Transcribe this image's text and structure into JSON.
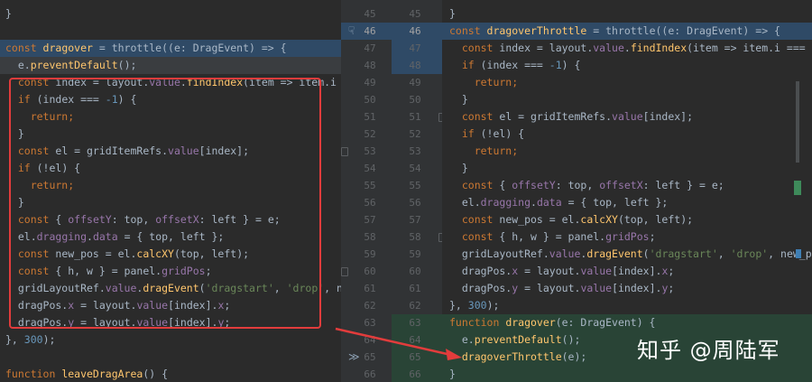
{
  "left_lines": [
    [
      {
        "t": "}",
        "k": "plain"
      }
    ],
    [],
    [
      {
        "t": "const ",
        "k": "kw"
      },
      {
        "t": "dragover",
        "k": "fn"
      },
      {
        "t": " = throttle((e: DragEvent) => {",
        "k": "plain"
      }
    ],
    [
      {
        "t": "  e.",
        "k": "plain"
      },
      {
        "t": "preventDefault",
        "k": "fn"
      },
      {
        "t": "();",
        "k": "plain"
      }
    ],
    [
      {
        "t": "  const ",
        "k": "kw"
      },
      {
        "t": "index = layout.",
        "k": "plain"
      },
      {
        "t": "value",
        "k": "prop"
      },
      {
        "t": ".",
        "k": "plain"
      },
      {
        "t": "findIndex",
        "k": "fn"
      },
      {
        "t": "(item => item.i ==",
        "k": "plain"
      }
    ],
    [
      {
        "t": "  if ",
        "k": "kw"
      },
      {
        "t": "(index === ",
        "k": "plain"
      },
      {
        "t": "-1",
        "k": "num"
      },
      {
        "t": ") {",
        "k": "plain"
      }
    ],
    [
      {
        "t": "    return;",
        "k": "kw"
      }
    ],
    [
      {
        "t": "  }",
        "k": "plain"
      }
    ],
    [
      {
        "t": "  const ",
        "k": "kw"
      },
      {
        "t": "el = gridItemRefs.",
        "k": "plain"
      },
      {
        "t": "value",
        "k": "prop"
      },
      {
        "t": "[index];",
        "k": "plain"
      }
    ],
    [
      {
        "t": "  if ",
        "k": "kw"
      },
      {
        "t": "(!el) {",
        "k": "plain"
      }
    ],
    [
      {
        "t": "    return;",
        "k": "kw"
      }
    ],
    [
      {
        "t": "  }",
        "k": "plain"
      }
    ],
    [
      {
        "t": "  const ",
        "k": "kw"
      },
      {
        "t": "{ ",
        "k": "plain"
      },
      {
        "t": "offsetY",
        "k": "prop"
      },
      {
        "t": ": top, ",
        "k": "plain"
      },
      {
        "t": "offsetX",
        "k": "prop"
      },
      {
        "t": ": left } = e;",
        "k": "plain"
      }
    ],
    [
      {
        "t": "  el.",
        "k": "plain"
      },
      {
        "t": "dragging",
        "k": "prop"
      },
      {
        "t": ".",
        "k": "plain"
      },
      {
        "t": "data",
        "k": "prop"
      },
      {
        "t": " = { top, left };",
        "k": "plain"
      }
    ],
    [
      {
        "t": "  const ",
        "k": "kw"
      },
      {
        "t": "new_pos = el.",
        "k": "plain"
      },
      {
        "t": "calcXY",
        "k": "fn"
      },
      {
        "t": "(top, left);",
        "k": "plain"
      }
    ],
    [
      {
        "t": "  const ",
        "k": "kw"
      },
      {
        "t": "{ h, w } = panel.",
        "k": "plain"
      },
      {
        "t": "gridPos",
        "k": "prop"
      },
      {
        "t": ";",
        "k": "plain"
      }
    ],
    [
      {
        "t": "  gridLayoutRef.",
        "k": "plain"
      },
      {
        "t": "value",
        "k": "prop"
      },
      {
        "t": ".",
        "k": "plain"
      },
      {
        "t": "dragEvent",
        "k": "fn"
      },
      {
        "t": "(",
        "k": "plain"
      },
      {
        "t": "'dragstart'",
        "k": "str"
      },
      {
        "t": ", ",
        "k": "plain"
      },
      {
        "t": "'drop'",
        "k": "str"
      },
      {
        "t": ", new",
        "k": "plain"
      }
    ],
    [
      {
        "t": "  dragPos.",
        "k": "plain"
      },
      {
        "t": "x",
        "k": "prop"
      },
      {
        "t": " = layout.",
        "k": "plain"
      },
      {
        "t": "value",
        "k": "prop"
      },
      {
        "t": "[index].",
        "k": "plain"
      },
      {
        "t": "x",
        "k": "prop"
      },
      {
        "t": ";",
        "k": "plain"
      }
    ],
    [
      {
        "t": "  dragPos.",
        "k": "plain"
      },
      {
        "t": "y",
        "k": "prop"
      },
      {
        "t": " = layout.",
        "k": "plain"
      },
      {
        "t": "value",
        "k": "prop"
      },
      {
        "t": "[index].",
        "k": "plain"
      },
      {
        "t": "y",
        "k": "prop"
      },
      {
        "t": ";",
        "k": "plain"
      }
    ],
    [
      {
        "t": "}, ",
        "k": "plain"
      },
      {
        "t": "300",
        "k": "num"
      },
      {
        "t": ");",
        "k": "plain"
      }
    ],
    [],
    [
      {
        "t": "function ",
        "k": "kw"
      },
      {
        "t": "leaveDragArea",
        "k": "fn"
      },
      {
        "t": "() {",
        "k": "plain"
      }
    ]
  ],
  "right_lines": [
    [
      {
        "t": "}",
        "k": "plain"
      }
    ],
    [
      {
        "t": "const ",
        "k": "kw"
      },
      {
        "t": "dragoverThrottle",
        "k": "fn"
      },
      {
        "t": " = throttle((e: DragEvent) => {",
        "k": "plain"
      }
    ],
    [
      {
        "t": "  const ",
        "k": "kw"
      },
      {
        "t": "index = layout.",
        "k": "plain"
      },
      {
        "t": "value",
        "k": "prop"
      },
      {
        "t": ".",
        "k": "plain"
      },
      {
        "t": "findIndex",
        "k": "fn"
      },
      {
        "t": "(item => item.i ===",
        "k": "plain"
      }
    ],
    [
      {
        "t": "  if ",
        "k": "kw"
      },
      {
        "t": "(index === ",
        "k": "plain"
      },
      {
        "t": "-1",
        "k": "num"
      },
      {
        "t": ") {",
        "k": "plain"
      }
    ],
    [
      {
        "t": "    return;",
        "k": "kw"
      }
    ],
    [
      {
        "t": "  }",
        "k": "plain"
      }
    ],
    [
      {
        "t": "  const ",
        "k": "kw"
      },
      {
        "t": "el = gridItemRefs.",
        "k": "plain"
      },
      {
        "t": "value",
        "k": "prop"
      },
      {
        "t": "[index];",
        "k": "plain"
      }
    ],
    [
      {
        "t": "  if ",
        "k": "kw"
      },
      {
        "t": "(!el) {",
        "k": "plain"
      }
    ],
    [
      {
        "t": "    return;",
        "k": "kw"
      }
    ],
    [
      {
        "t": "  }",
        "k": "plain"
      }
    ],
    [
      {
        "t": "  const ",
        "k": "kw"
      },
      {
        "t": "{ ",
        "k": "plain"
      },
      {
        "t": "offsetY",
        "k": "prop"
      },
      {
        "t": ": top, ",
        "k": "plain"
      },
      {
        "t": "offsetX",
        "k": "prop"
      },
      {
        "t": ": left } = e;",
        "k": "plain"
      }
    ],
    [
      {
        "t": "  el.",
        "k": "plain"
      },
      {
        "t": "dragging",
        "k": "prop"
      },
      {
        "t": ".",
        "k": "plain"
      },
      {
        "t": "data",
        "k": "prop"
      },
      {
        "t": " = { top, left };",
        "k": "plain"
      }
    ],
    [
      {
        "t": "  const ",
        "k": "kw"
      },
      {
        "t": "new_pos = el.",
        "k": "plain"
      },
      {
        "t": "calcXY",
        "k": "fn"
      },
      {
        "t": "(top, left);",
        "k": "plain"
      }
    ],
    [
      {
        "t": "  const ",
        "k": "kw"
      },
      {
        "t": "{ h, w } = panel.",
        "k": "plain"
      },
      {
        "t": "gridPos",
        "k": "prop"
      },
      {
        "t": ";",
        "k": "plain"
      }
    ],
    [
      {
        "t": "  gridLayoutRef.",
        "k": "plain"
      },
      {
        "t": "value",
        "k": "prop"
      },
      {
        "t": ".",
        "k": "plain"
      },
      {
        "t": "dragEvent",
        "k": "fn"
      },
      {
        "t": "(",
        "k": "plain"
      },
      {
        "t": "'dragstart'",
        "k": "str"
      },
      {
        "t": ", ",
        "k": "plain"
      },
      {
        "t": "'drop'",
        "k": "str"
      },
      {
        "t": ", new_p",
        "k": "plain"
      }
    ],
    [
      {
        "t": "  dragPos.",
        "k": "plain"
      },
      {
        "t": "x",
        "k": "prop"
      },
      {
        "t": " = layout.",
        "k": "plain"
      },
      {
        "t": "value",
        "k": "prop"
      },
      {
        "t": "[index].",
        "k": "plain"
      },
      {
        "t": "x",
        "k": "prop"
      },
      {
        "t": ";",
        "k": "plain"
      }
    ],
    [
      {
        "t": "  dragPos.",
        "k": "plain"
      },
      {
        "t": "y",
        "k": "prop"
      },
      {
        "t": " = layout.",
        "k": "plain"
      },
      {
        "t": "value",
        "k": "prop"
      },
      {
        "t": "[index].",
        "k": "plain"
      },
      {
        "t": "y",
        "k": "prop"
      },
      {
        "t": ";",
        "k": "plain"
      }
    ],
    [
      {
        "t": "}, ",
        "k": "plain"
      },
      {
        "t": "300",
        "k": "num"
      },
      {
        "t": ");",
        "k": "plain"
      }
    ],
    [
      {
        "t": "function ",
        "k": "kw"
      },
      {
        "t": "dragover",
        "k": "fn"
      },
      {
        "t": "(e: DragEvent) {",
        "k": "plain"
      }
    ],
    [
      {
        "t": "  e.",
        "k": "plain"
      },
      {
        "t": "preventDefault",
        "k": "fn"
      },
      {
        "t": "();",
        "k": "plain"
      }
    ],
    [
      {
        "t": "  dragoverThrottle",
        "k": "fn"
      },
      {
        "t": "(e);",
        "k": "plain"
      }
    ],
    [
      {
        "t": "}",
        "k": "plain"
      }
    ]
  ],
  "line_numbers": {
    "left": [
      "45",
      "46",
      "47",
      "48",
      "49",
      "50",
      "51",
      "52",
      "53",
      "54",
      "55",
      "56",
      "57",
      "58",
      "59",
      "60",
      "61",
      "62",
      "63",
      "64",
      "65",
      "66"
    ],
    "right": [
      "45",
      "46",
      "47",
      "48",
      "49",
      "50",
      "51",
      "52",
      "53",
      "54",
      "55",
      "56",
      "57",
      "58",
      "59",
      "60",
      "61",
      "62",
      "63",
      "64",
      "65",
      "66"
    ]
  },
  "watermark": "知乎 @周陆军",
  "colors": {
    "editor_bg": "#2b2b2b",
    "gutter_bg": "#313335",
    "changed_block": "#2f4a66",
    "added_block": "#294436",
    "annotation_red": "#e23c3c"
  }
}
